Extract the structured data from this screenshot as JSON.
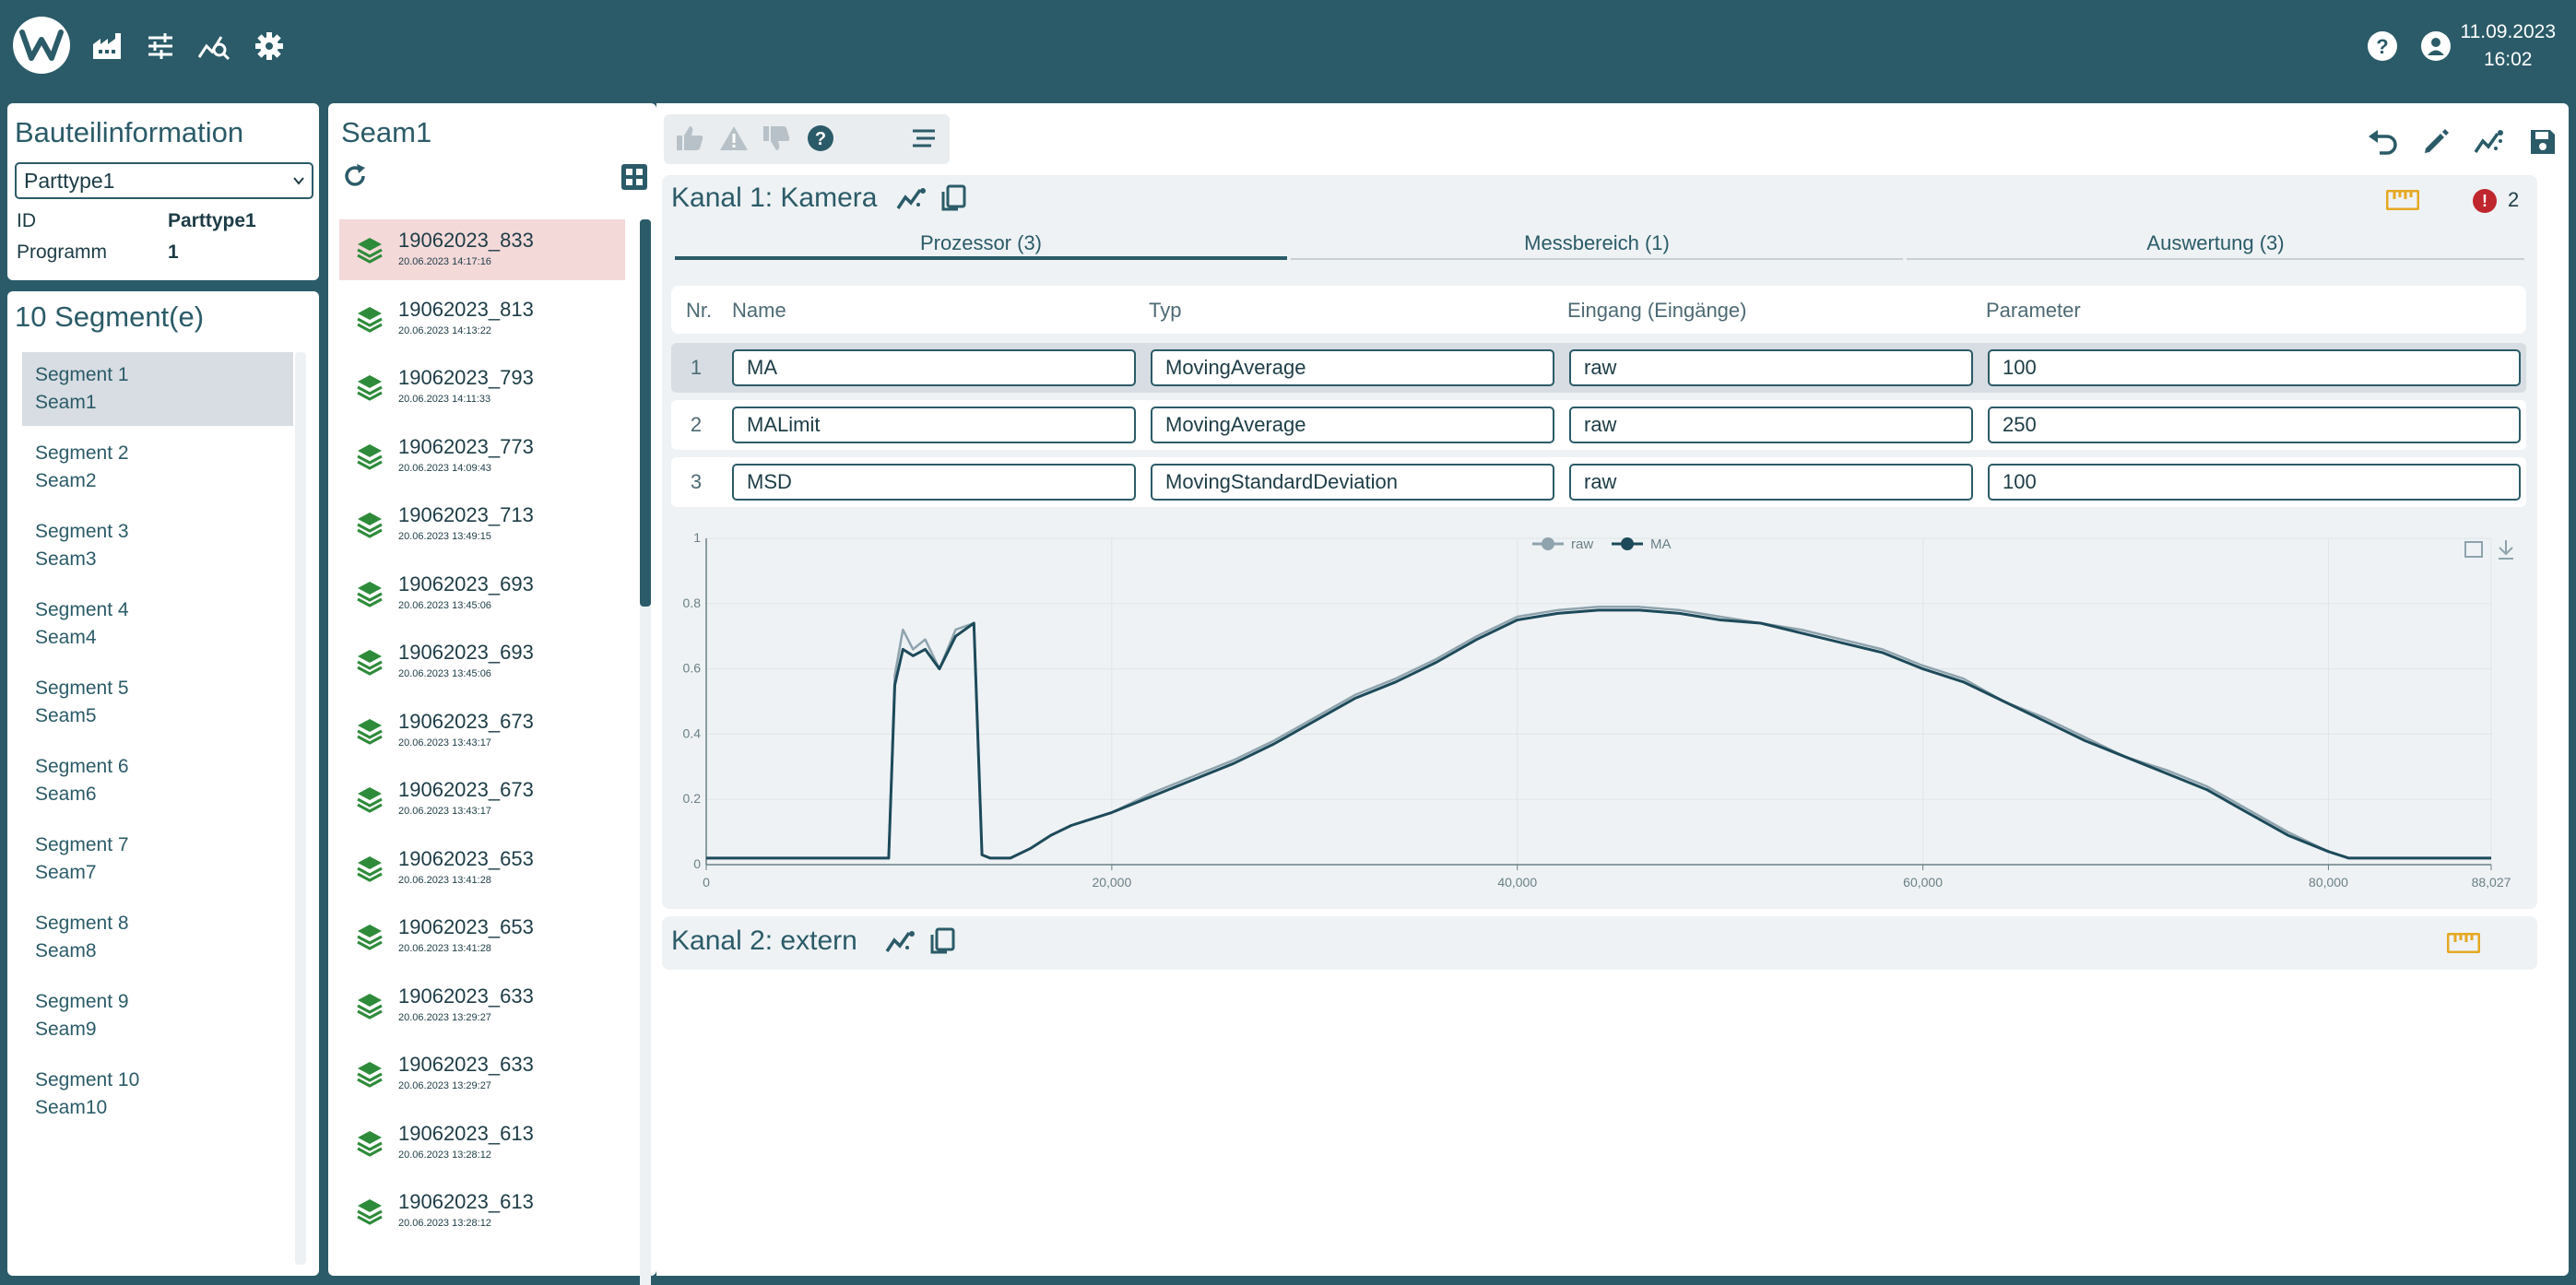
{
  "header": {
    "date": "11.09.2023",
    "time": "16:02",
    "icons": [
      "factory-icon",
      "sliders-icon",
      "analysis-icon",
      "gear-icon",
      "help-icon",
      "account-icon"
    ]
  },
  "part_info": {
    "title": "Bauteilinformation",
    "selected_part": "Parttype1",
    "id_label": "ID",
    "id_value": "Parttype1",
    "program_label": "Programm",
    "program_value": "1"
  },
  "segments": {
    "title": "10 Segment(e)",
    "items": [
      {
        "segment": "Segment 1",
        "seam": "Seam1"
      },
      {
        "segment": "Segment 2",
        "seam": "Seam2"
      },
      {
        "segment": "Segment 3",
        "seam": "Seam3"
      },
      {
        "segment": "Segment 4",
        "seam": "Seam4"
      },
      {
        "segment": "Segment 5",
        "seam": "Seam5"
      },
      {
        "segment": "Segment 6",
        "seam": "Seam6"
      },
      {
        "segment": "Segment 7",
        "seam": "Seam7"
      },
      {
        "segment": "Segment 8",
        "seam": "Seam8"
      },
      {
        "segment": "Segment 9",
        "seam": "Seam9"
      },
      {
        "segment": "Segment 10",
        "seam": "Seam10"
      }
    ]
  },
  "seam_list": {
    "title": "Seam1",
    "items": [
      {
        "name": "19062023_833",
        "time": "20.06.2023 14:17:16"
      },
      {
        "name": "19062023_813",
        "time": "20.06.2023 14:13:22"
      },
      {
        "name": "19062023_793",
        "time": "20.06.2023 14:11:33"
      },
      {
        "name": "19062023_773",
        "time": "20.06.2023 14:09:43"
      },
      {
        "name": "19062023_713",
        "time": "20.06.2023 13:49:15"
      },
      {
        "name": "19062023_693",
        "time": "20.06.2023 13:45:06"
      },
      {
        "name": "19062023_693",
        "time": "20.06.2023 13:45:06"
      },
      {
        "name": "19062023_673",
        "time": "20.06.2023 13:43:17"
      },
      {
        "name": "19062023_673",
        "time": "20.06.2023 13:43:17"
      },
      {
        "name": "19062023_653",
        "time": "20.06.2023 13:41:28"
      },
      {
        "name": "19062023_653",
        "time": "20.06.2023 13:41:28"
      },
      {
        "name": "19062023_633",
        "time": "20.06.2023 13:29:27"
      },
      {
        "name": "19062023_633",
        "time": "20.06.2023 13:29:27"
      },
      {
        "name": "19062023_613",
        "time": "20.06.2023 13:28:12"
      },
      {
        "name": "19062023_613",
        "time": "20.06.2023 13:28:12"
      }
    ]
  },
  "channel1": {
    "title": "Kanal 1: Kamera",
    "error_count": "2",
    "tabs": [
      "Prozessor (3)",
      "Messbereich (1)",
      "Auswertung (3)"
    ],
    "columns": [
      "Nr.",
      "Name",
      "Typ",
      "Eingang (Eingänge)",
      "Parameter"
    ],
    "rows": [
      {
        "nr": "1",
        "name": "MA",
        "typ": "MovingAverage",
        "eingang": "raw",
        "parameter": "100"
      },
      {
        "nr": "2",
        "name": "MALimit",
        "typ": "MovingAverage",
        "eingang": "raw",
        "parameter": "250"
      },
      {
        "nr": "3",
        "name": "MSD",
        "typ": "MovingStandardDeviation",
        "eingang": "raw",
        "parameter": "100"
      }
    ]
  },
  "channel2": {
    "title": "Kanal 2: extern"
  },
  "colors": {
    "header_bg": "#2b5b68",
    "accent": "#2b5b68",
    "raw_series": "#8fa3ad",
    "ma_series": "#1d4a5a",
    "error": "#c0262d",
    "ruler": "#e5a823",
    "seam_ok": "#2e8b3a",
    "active_seam_bg": "#f4d9d9"
  },
  "chart_data": {
    "type": "line",
    "title": "",
    "xlabel": "",
    "ylabel": "",
    "xlim": [
      0,
      88027
    ],
    "ylim": [
      0,
      1
    ],
    "x_ticks": [
      "0",
      "20,000",
      "40,000",
      "60,000",
      "80,000",
      "88,027"
    ],
    "y_ticks": [
      "0",
      "0.2",
      "0.4",
      "0.6",
      "0.8",
      "1"
    ],
    "legend_position": "top-center",
    "grid": true,
    "series": [
      {
        "name": "raw",
        "x": [
          0,
          9000,
          9300,
          9700,
          10200,
          10800,
          11500,
          12300,
          13200,
          13600,
          14000,
          15000,
          16000,
          17000,
          18000,
          20000,
          22000,
          24000,
          26000,
          28000,
          30000,
          32000,
          34000,
          36000,
          38000,
          40000,
          42000,
          44000,
          46000,
          48000,
          50000,
          52000,
          54000,
          56000,
          58000,
          60000,
          62000,
          64000,
          66000,
          68000,
          70000,
          72000,
          74000,
          76000,
          78000,
          80000,
          81000,
          82000,
          88027
        ],
        "y": [
          0.02,
          0.02,
          0.58,
          0.72,
          0.66,
          0.69,
          0.6,
          0.72,
          0.74,
          0.03,
          0.02,
          0.02,
          0.05,
          0.09,
          0.12,
          0.16,
          0.22,
          0.27,
          0.32,
          0.38,
          0.45,
          0.52,
          0.57,
          0.63,
          0.7,
          0.76,
          0.78,
          0.79,
          0.79,
          0.78,
          0.76,
          0.74,
          0.72,
          0.69,
          0.66,
          0.61,
          0.57,
          0.5,
          0.45,
          0.39,
          0.33,
          0.29,
          0.24,
          0.17,
          0.1,
          0.04,
          0.02,
          0.02,
          0.02
        ]
      },
      {
        "name": "MA",
        "x": [
          0,
          9000,
          9300,
          9700,
          10200,
          10800,
          11500,
          12300,
          13200,
          13600,
          14000,
          15000,
          16000,
          17000,
          18000,
          20000,
          22000,
          24000,
          26000,
          28000,
          30000,
          32000,
          34000,
          36000,
          38000,
          40000,
          42000,
          44000,
          46000,
          48000,
          50000,
          52000,
          54000,
          56000,
          58000,
          60000,
          62000,
          64000,
          66000,
          68000,
          70000,
          72000,
          74000,
          76000,
          78000,
          80000,
          81000,
          82000,
          88027
        ],
        "y": [
          0.02,
          0.02,
          0.55,
          0.66,
          0.64,
          0.66,
          0.6,
          0.7,
          0.74,
          0.03,
          0.02,
          0.02,
          0.05,
          0.09,
          0.12,
          0.16,
          0.21,
          0.26,
          0.31,
          0.37,
          0.44,
          0.51,
          0.56,
          0.62,
          0.69,
          0.75,
          0.77,
          0.78,
          0.78,
          0.77,
          0.75,
          0.74,
          0.71,
          0.68,
          0.65,
          0.6,
          0.56,
          0.5,
          0.44,
          0.38,
          0.33,
          0.28,
          0.23,
          0.16,
          0.09,
          0.04,
          0.02,
          0.02,
          0.02
        ]
      }
    ]
  }
}
